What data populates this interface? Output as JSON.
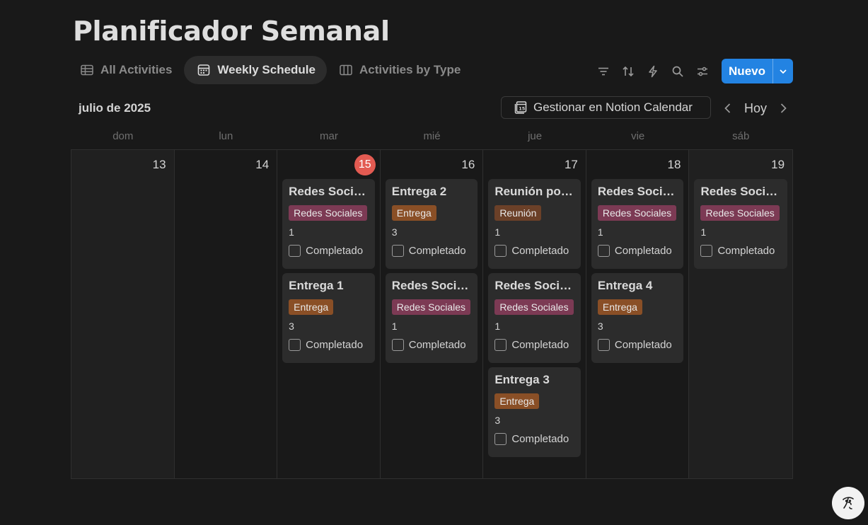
{
  "page": {
    "title": "Planificador Semanal"
  },
  "tabs": [
    {
      "label": "All Activities",
      "icon": "table-icon",
      "active": false
    },
    {
      "label": "Weekly Schedule",
      "icon": "calendar-icon",
      "active": true
    },
    {
      "label": "Activities by Type",
      "icon": "board-icon",
      "active": false
    }
  ],
  "toolbar": {
    "new_label": "Nuevo"
  },
  "calendar": {
    "month_label": "julio de 2025",
    "manage_label": "Gestionar en Notion Calendar",
    "today_label": "Hoy",
    "weekdays": [
      "dom",
      "lun",
      "mar",
      "mié",
      "jue",
      "vie",
      "sáb"
    ],
    "days": [
      {
        "num": "13",
        "today": false,
        "cards": []
      },
      {
        "num": "14",
        "today": false,
        "cards": []
      },
      {
        "num": "15",
        "today": true,
        "cards": [
          {
            "title": "Redes Social...",
            "tag": "Redes Sociales",
            "tag_type": "redes",
            "value": "1",
            "check": "Completado"
          },
          {
            "title": "Entrega 1",
            "tag": "Entrega",
            "tag_type": "entrega",
            "value": "3",
            "check": "Completado"
          }
        ]
      },
      {
        "num": "16",
        "today": false,
        "cards": [
          {
            "title": "Entrega 2",
            "tag": "Entrega",
            "tag_type": "entrega",
            "value": "3",
            "check": "Completado"
          },
          {
            "title": "Redes Social...",
            "tag": "Redes Sociales",
            "tag_type": "redes",
            "value": "1",
            "check": "Completado"
          }
        ]
      },
      {
        "num": "17",
        "today": false,
        "cards": [
          {
            "title": "Reunión por ...",
            "tag": "Reunión",
            "tag_type": "reunion",
            "value": "1",
            "check": "Completado"
          },
          {
            "title": "Redes Social...",
            "tag": "Redes Sociales",
            "tag_type": "redes",
            "value": "1",
            "check": "Completado"
          },
          {
            "title": "Entrega 3",
            "tag": "Entrega",
            "tag_type": "entrega",
            "value": "3",
            "check": "Completado"
          }
        ]
      },
      {
        "num": "18",
        "today": false,
        "cards": [
          {
            "title": "Redes Social...",
            "tag": "Redes Sociales",
            "tag_type": "redes",
            "value": "1",
            "check": "Completado"
          },
          {
            "title": "Entrega 4",
            "tag": "Entrega",
            "tag_type": "entrega",
            "value": "3",
            "check": "Completado"
          }
        ]
      },
      {
        "num": "19",
        "today": false,
        "cards": [
          {
            "title": "Redes Social...",
            "tag": "Redes Sociales",
            "tag_type": "redes",
            "value": "1",
            "check": "Completado"
          }
        ]
      }
    ]
  },
  "colors": {
    "accent": "#2383e2",
    "today": "#e35b52",
    "redes": "#7c3a54",
    "entrega": "#8a4f26",
    "reunion": "#6b4028"
  }
}
